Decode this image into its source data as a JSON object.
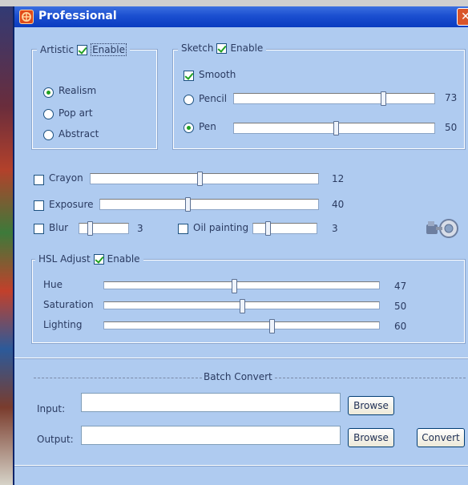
{
  "window": {
    "title": "Professional",
    "close_glyph": "✕"
  },
  "artistic": {
    "legend": "Artistic",
    "enable_label": "Enable",
    "enabled": true,
    "options": [
      {
        "label": "Realism",
        "selected": true
      },
      {
        "label": "Pop art",
        "selected": false
      },
      {
        "label": "Abstract",
        "selected": false
      }
    ]
  },
  "sketch": {
    "legend": "Sketch",
    "enable_label": "Enable",
    "enabled": true,
    "smooth_label": "Smooth",
    "smooth_checked": true,
    "pencil": {
      "label": "Pencil",
      "selected": false,
      "value": "73"
    },
    "pen": {
      "label": "Pen",
      "selected": true,
      "value": "50"
    }
  },
  "effects": {
    "crayon": {
      "label": "Crayon",
      "checked": false,
      "value": "12"
    },
    "exposure": {
      "label": "Exposure",
      "checked": false,
      "value": "40"
    },
    "blur": {
      "label": "Blur",
      "checked": false,
      "value": "3"
    },
    "oil": {
      "label": "Oil painting",
      "checked": false,
      "value": "3"
    },
    "settings_icon": "gear-tool-icon"
  },
  "hsl": {
    "legend": "HSL Adjust",
    "enable_label": "Enable",
    "enabled": true,
    "hue": {
      "label": "Hue",
      "value": "47"
    },
    "saturation": {
      "label": "Saturation",
      "value": "50"
    },
    "lighting": {
      "label": "Lighting",
      "value": "60"
    }
  },
  "batch": {
    "title": "Batch Convert",
    "input_label": "Input:",
    "output_label": "Output:",
    "input_value": "",
    "output_value": "",
    "browse_label": "Browse",
    "convert_label": "Convert"
  },
  "colors": {
    "window_bg": "#afcbf0",
    "titlebar": "#1b4fd0",
    "check_green": "#21a121"
  }
}
